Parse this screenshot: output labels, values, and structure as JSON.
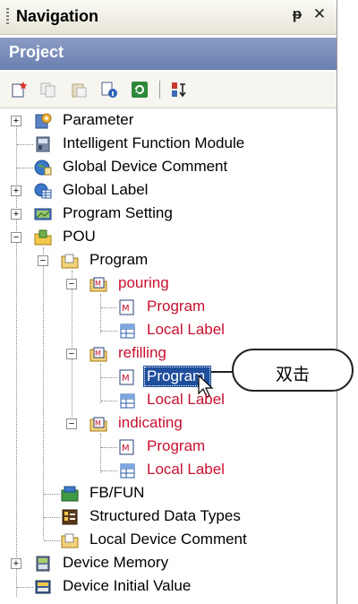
{
  "titlebar": {
    "title": "Navigation",
    "pin_label": "⊥",
    "close_label": "✕"
  },
  "project_header": {
    "label": "Project"
  },
  "tree": {
    "parameter": "Parameter",
    "intelligent_function_module": "Intelligent Function Module",
    "global_device_comment": "Global Device Comment",
    "global_label": "Global Label",
    "program_setting": "Program Setting",
    "pou": "POU",
    "program_folder": "Program",
    "pouring": "pouring",
    "pouring_program": "Program",
    "pouring_local_label": "Local Label",
    "refilling": "refilling",
    "refilling_program": "Program",
    "refilling_local_label": "Local Label",
    "indicating": "indicating",
    "indicating_program": "Program",
    "indicating_local_label": "Local Label",
    "fb_fun": "FB/FUN",
    "structured_data_types": "Structured Data Types",
    "local_device_comment": "Local Device Comment",
    "device_memory": "Device Memory",
    "device_initial_value": "Device Initial Value"
  },
  "callout": {
    "text": "双击"
  },
  "colors": {
    "header_blue": "#7384b5",
    "red_item": "#c8102e",
    "selection": "#1f4f9c"
  }
}
